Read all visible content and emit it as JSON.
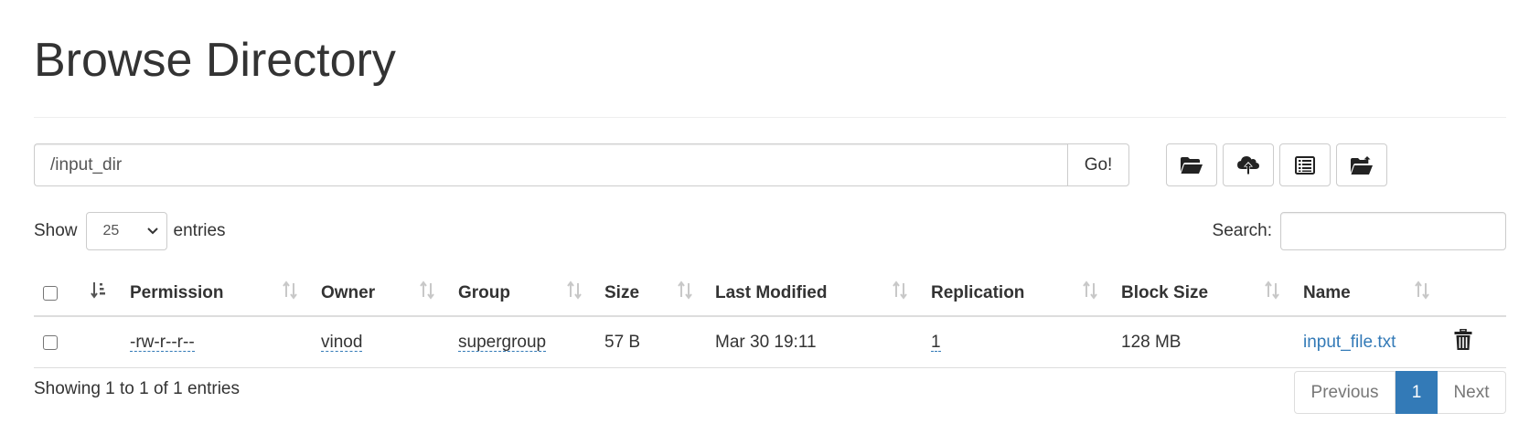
{
  "page": {
    "title": "Browse Directory"
  },
  "pathbar": {
    "value": "/input_dir",
    "go_label": "Go!"
  },
  "toolbar": {
    "icons": [
      "folder-open-icon",
      "cloud-upload-icon",
      "list-alt-icon",
      "create-folder-icon"
    ]
  },
  "controls": {
    "show_label": "Show",
    "entries_value": "25",
    "entries_label": "entries",
    "search_label": "Search:",
    "search_value": ""
  },
  "table": {
    "headers": {
      "permission": "Permission",
      "owner": "Owner",
      "group": "Group",
      "size": "Size",
      "last_modified": "Last Modified",
      "replication": "Replication",
      "block_size": "Block Size",
      "name": "Name"
    },
    "rows": [
      {
        "permission": "-rw-r--r--",
        "owner": "vinod",
        "group": "supergroup",
        "size": "57 B",
        "last_modified": "Mar 30 19:11",
        "replication": "1",
        "block_size": "128 MB",
        "name": "input_file.txt"
      }
    ]
  },
  "footer": {
    "info": "Showing 1 to 1 of 1 entries",
    "previous_label": "Previous",
    "current_page": "1",
    "next_label": "Next"
  },
  "colors": {
    "link": "#337ab7",
    "active_page_bg": "#337ab7",
    "text": "#333333",
    "border": "#cccccc"
  }
}
